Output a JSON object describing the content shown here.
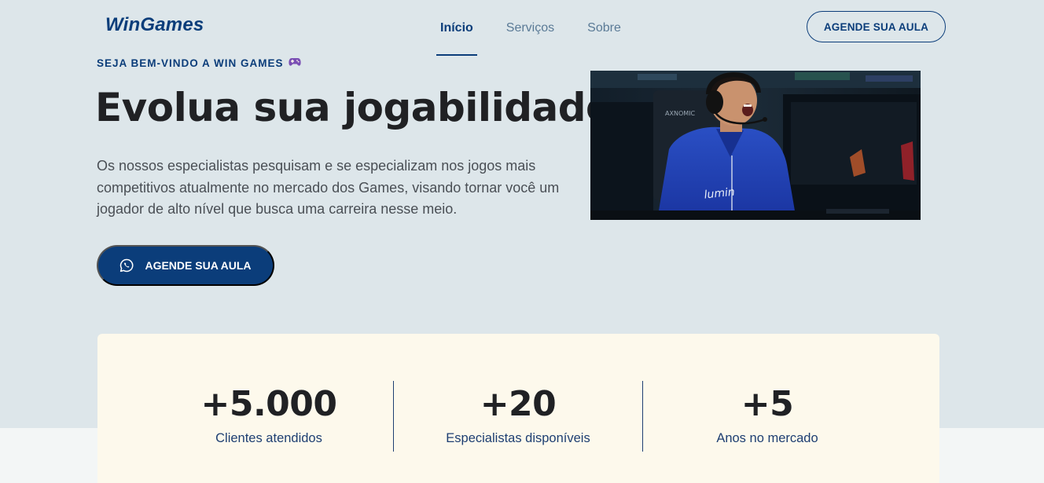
{
  "header": {
    "logo": "WinGames",
    "nav": [
      {
        "label": "Início",
        "active": true
      },
      {
        "label": "Serviços",
        "active": false
      },
      {
        "label": "Sobre",
        "active": false
      }
    ],
    "cta_label": "AGENDE SUA AULA"
  },
  "hero": {
    "eyebrow": "SEJA BEM-VINDO A WIN GAMES",
    "eyebrow_icon": "gamepad-icon",
    "title": "Evolua sua jogabilidade!",
    "description": "Os nossos especialistas pesquisam e se especializam nos jogos mais competitivos atualmente no mercado dos Games, visando tornar você um jogador de alto nível que busca uma carreira nesse meio.",
    "cta_label": "AGENDE SUA AULA",
    "cta_icon": "whatsapp-icon"
  },
  "stats": [
    {
      "value": "+5.000",
      "label": "Clientes atendidos"
    },
    {
      "value": "+20",
      "label": "Especialistas disponíveis"
    },
    {
      "value": "+5",
      "label": "Anos no mercado"
    }
  ],
  "colors": {
    "brand": "#0b3d7a",
    "background": "#dde6ea",
    "stats_card": "#fdf9ec"
  }
}
